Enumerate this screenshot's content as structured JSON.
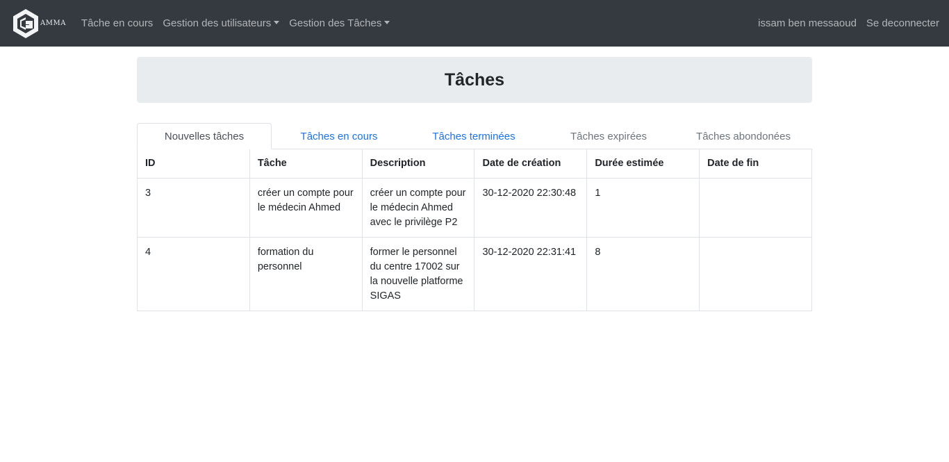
{
  "navbar": {
    "brand_text": "AMMA",
    "links": [
      {
        "label": "Tâche en cours",
        "dropdown": false
      },
      {
        "label": "Gestion des utilisateurs",
        "dropdown": true
      },
      {
        "label": "Gestion des Tâches",
        "dropdown": true
      }
    ],
    "user_name": "issam ben messaoud",
    "logout_label": "Se deconnecter"
  },
  "page": {
    "title": "Tâches"
  },
  "tabs": [
    {
      "label": "Nouvelles tâches",
      "state": "active"
    },
    {
      "label": "Tâches en cours",
      "state": "link"
    },
    {
      "label": "Tâches terminées",
      "state": "link"
    },
    {
      "label": "Tâches expirées",
      "state": "muted"
    },
    {
      "label": "Tâches abondonées",
      "state": "muted"
    }
  ],
  "table": {
    "columns": [
      "ID",
      "Tâche",
      "Description",
      "Date de création",
      "Durée estimée",
      "Date de fin"
    ],
    "rows": [
      [
        "3",
        "créer un compte pour le médecin Ahmed",
        "créer un compte pour le médecin Ahmed avec le privilège P2",
        "30-12-2020 22:30:48",
        "1",
        ""
      ],
      [
        "4",
        "formation du personnel",
        "former le personnel du centre 17002 sur la nouvelle platforme SIGAS",
        "30-12-2020 22:31:41",
        "8",
        ""
      ]
    ]
  },
  "colors": {
    "navbar_bg": "#343a40",
    "jumbotron_bg": "#e9ecef",
    "link": "#1a73e8",
    "muted": "#6c757d"
  }
}
